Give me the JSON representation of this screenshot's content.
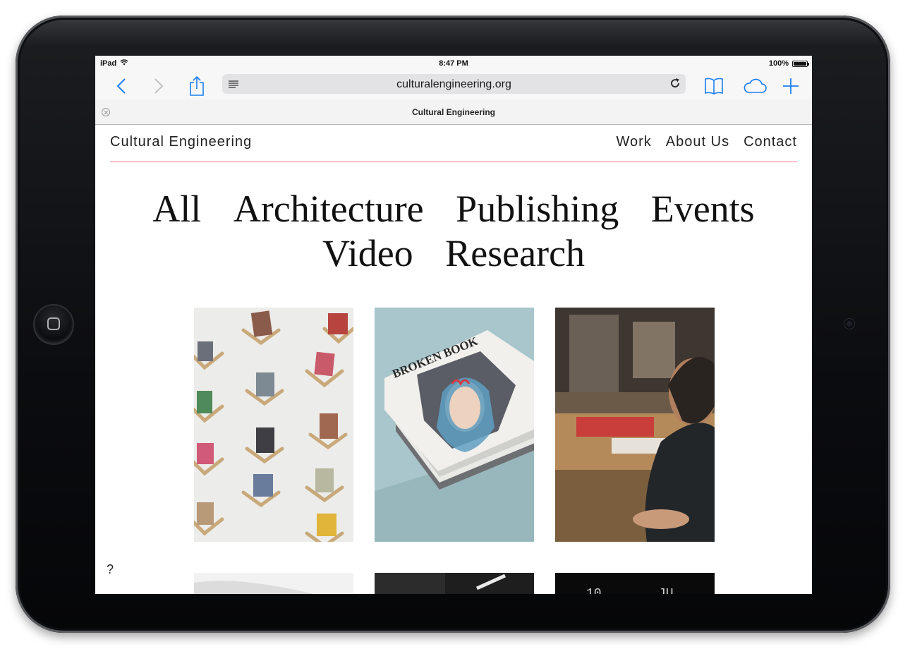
{
  "status_bar": {
    "device": "iPad",
    "time": "8:47 PM",
    "battery": "100%"
  },
  "toolbar": {
    "url": "culturalengineering.org",
    "icons": [
      "back-icon",
      "forward-icon",
      "share-icon",
      "reader-icon",
      "reload-icon",
      "bookmarks-icon",
      "cloud-tabs-icon",
      "new-tab-icon"
    ]
  },
  "tab": {
    "title": "Cultural Engineering"
  },
  "site": {
    "brand": "Cultural Engineering",
    "nav": [
      "Work",
      "About Us",
      "Contact"
    ]
  },
  "categories": {
    "row1": [
      "All",
      "Architecture",
      "Publishing",
      "Events"
    ],
    "row2": [
      "Video",
      "Research"
    ]
  },
  "thumbs": {
    "t6_partial_text_a": "10",
    "t6_partial_text_b": "JU"
  },
  "help": "?",
  "colors": {
    "accent_rule": "#e9758f",
    "link_blue": "#1a7ef4",
    "frame": "#0b0c0f"
  }
}
